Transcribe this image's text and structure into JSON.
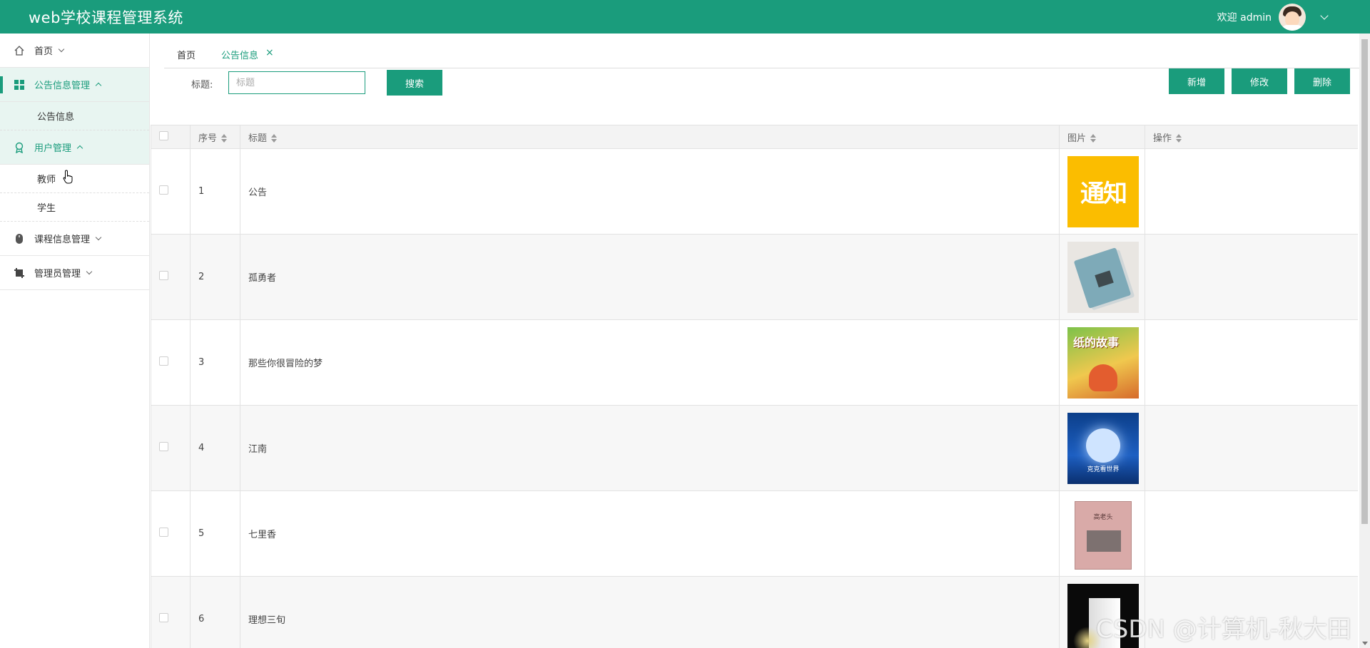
{
  "header": {
    "title": "web学校课程管理系统",
    "welcome": "欢迎 admin",
    "bg_color": "#1a9c7c"
  },
  "sidebar": {
    "items": [
      {
        "label": "首页",
        "icon": "home-icon"
      },
      {
        "label": "公告信息管理",
        "icon": "grid-icon",
        "sub": [
          {
            "label": "公告信息"
          }
        ]
      },
      {
        "label": "用户管理",
        "icon": "user-badge-icon",
        "sub": [
          {
            "label": "教师"
          },
          {
            "label": "学生"
          }
        ]
      },
      {
        "label": "课程信息管理",
        "icon": "mouse-icon"
      },
      {
        "label": "管理员管理",
        "icon": "crop-icon"
      }
    ]
  },
  "tabs": [
    {
      "label": "首页"
    },
    {
      "label": "公告信息",
      "close": "×"
    }
  ],
  "search": {
    "label": "标题:",
    "placeholder": "标题",
    "button": "搜索"
  },
  "actions": {
    "add": "新增",
    "edit": "修改",
    "delete": "删除"
  },
  "table": {
    "columns": [
      "序号",
      "标题",
      "图片",
      "操作"
    ],
    "rows": [
      {
        "index": "1",
        "title": "公告",
        "image_text": "通知"
      },
      {
        "index": "2",
        "title": "孤勇者"
      },
      {
        "index": "3",
        "title": "那些你很冒险的梦",
        "image_text": "纸的故事"
      },
      {
        "index": "4",
        "title": "江南",
        "image_text": "克克看世界"
      },
      {
        "index": "5",
        "title": "七里香",
        "image_text": "高老头"
      },
      {
        "index": "6",
        "title": "理想三旬"
      }
    ]
  },
  "watermark": "CSDN @计算机-秋大田"
}
